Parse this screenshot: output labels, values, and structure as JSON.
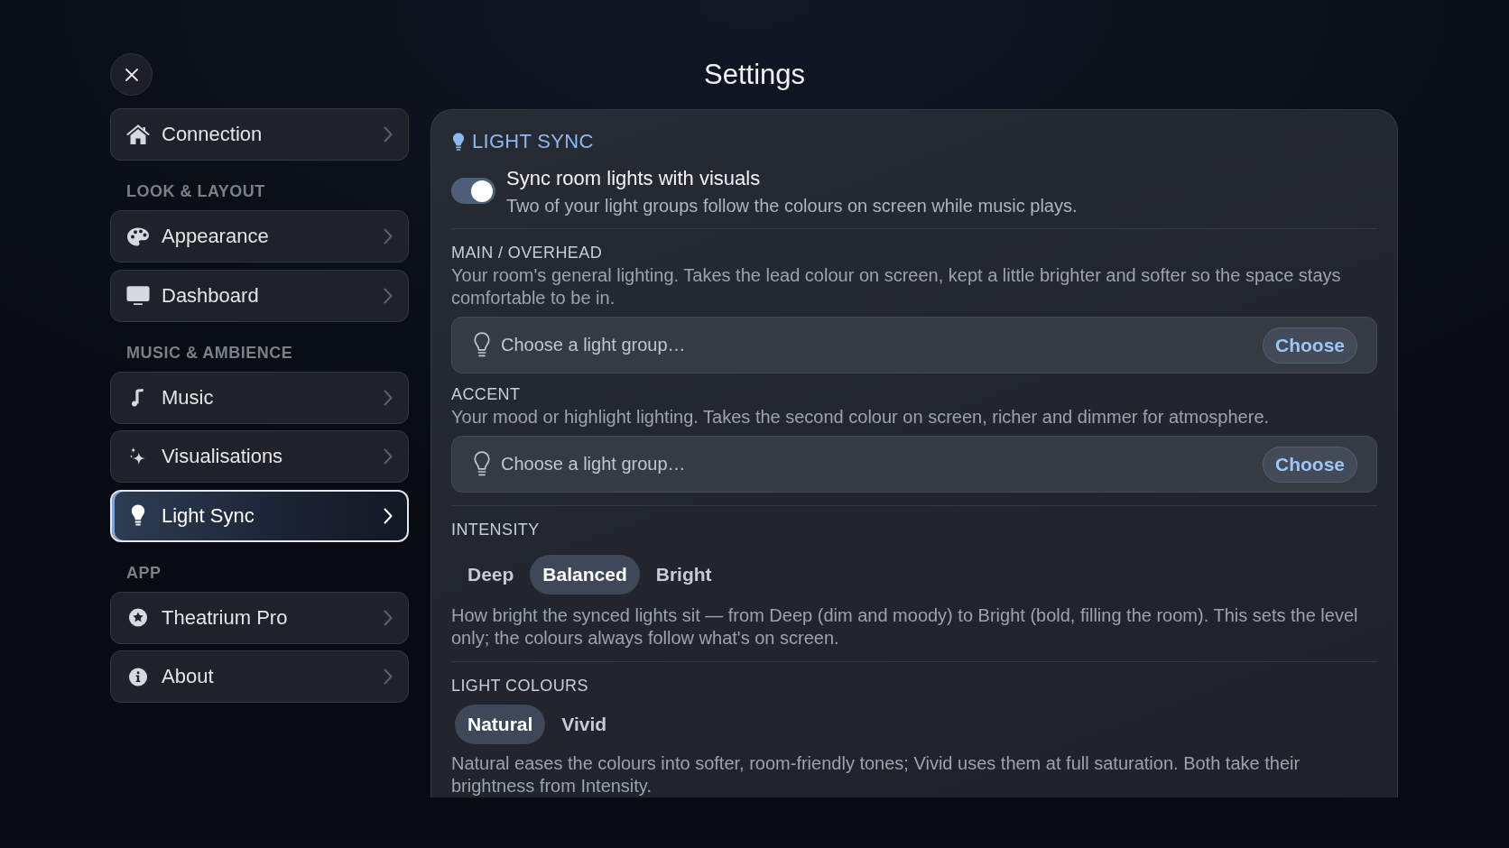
{
  "window": {
    "title": "Settings"
  },
  "sidebar": {
    "sections": [
      {
        "items": [
          {
            "label": "Connection",
            "selected": false
          }
        ]
      },
      {
        "heading": "LOOK & LAYOUT",
        "items": [
          {
            "label": "Appearance",
            "selected": false
          },
          {
            "label": "Dashboard",
            "selected": false
          }
        ]
      },
      {
        "heading": "MUSIC & AMBIENCE",
        "items": [
          {
            "label": "Music",
            "selected": false
          },
          {
            "label": "Visualisations",
            "selected": false
          },
          {
            "label": "Light Sync",
            "selected": true
          }
        ]
      },
      {
        "heading": "APP",
        "items": [
          {
            "label": "Theatrium Pro",
            "selected": false
          },
          {
            "label": "About",
            "selected": false
          }
        ]
      }
    ]
  },
  "panel": {
    "title": "LIGHT SYNC",
    "sync": {
      "label": "Sync room lights with visuals",
      "description": "Two of your light groups follow the colours on screen while music plays.",
      "on": true
    },
    "light_groups": [
      {
        "heading": "MAIN / OVERHEAD",
        "description": "Your room's general lighting. Takes the lead colour on screen, kept a little brighter and softer so the space stays comfortable to be in.",
        "placeholder": "Choose a light group…",
        "button": "Choose"
      },
      {
        "heading": "ACCENT",
        "description": "Your mood or highlight lighting. Takes the second colour on screen, richer and dimmer for atmosphere.",
        "placeholder": "Choose a light group…",
        "button": "Choose"
      }
    ],
    "intensity": {
      "heading": "INTENSITY",
      "options": [
        {
          "label": "Deep",
          "selected": false
        },
        {
          "label": "Balanced",
          "selected": true
        },
        {
          "label": "Bright",
          "selected": false
        }
      ],
      "description": "How bright the synced lights sit — from Deep (dim and moody) to Bright (bold, filling the room). This sets the level only; the colours always follow what's on screen."
    },
    "light_colours": {
      "heading": "LIGHT COLOURS",
      "options": [
        {
          "label": "Natural",
          "selected": true
        },
        {
          "label": "Vivid",
          "selected": false
        }
      ],
      "description": "Natural eases the colours into softer, room-friendly tones; Vivid uses them at full saturation. Both take their brightness from Intensity."
    }
  }
}
